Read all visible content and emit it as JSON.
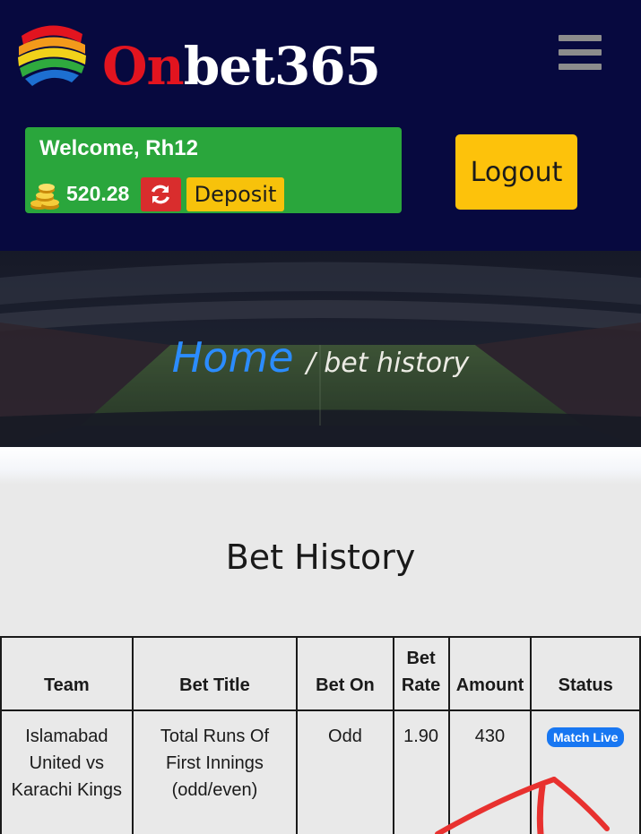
{
  "header": {
    "logo_text_red": "On",
    "logo_text_white": "bet365",
    "menu_icon": "hamburger-menu-icon"
  },
  "account": {
    "welcome": "Welcome, Rh12",
    "balance": "520.28",
    "balance_icon": "gold-coins-icon",
    "refresh_icon": "refresh-icon",
    "deposit_label": "Deposit",
    "logout_label": "Logout"
  },
  "breadcrumb": {
    "home": "Home",
    "current": "/ bet history"
  },
  "page": {
    "title": "Bet History"
  },
  "table": {
    "headers": [
      "Team",
      "Bet Title",
      "Bet On",
      "Bet Rate",
      "Amount",
      "Status"
    ],
    "header_lines": {
      "bet": "Bet",
      "rate": "Rate"
    },
    "rows": [
      {
        "team": "Islamabad United vs Karachi Kings",
        "bet_title": "Total Runs Of First Innings (odd/even)",
        "bet_on": "Odd",
        "bet_rate": "1.90",
        "amount": "430",
        "status": "Match Live"
      }
    ]
  },
  "colors": {
    "header_bg": "#07093f",
    "welcome_bg": "#2aa63c",
    "refresh_bg": "#d92d2d",
    "deposit_bg": "#f7c20b",
    "logout_bg": "#fdc20b",
    "home_link": "#2b8cff",
    "status_badge": "#1877f2",
    "annotation": "#e8312f"
  }
}
